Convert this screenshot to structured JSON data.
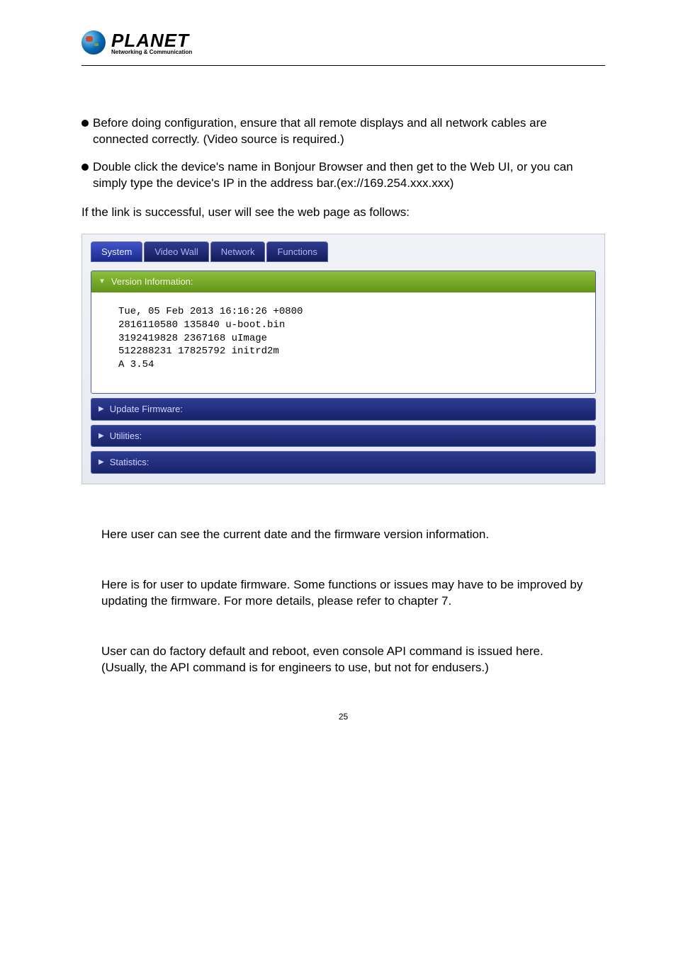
{
  "logo": {
    "word": "PLANET",
    "sub": "Networking & Communication"
  },
  "bullets": {
    "b1": "Before doing configuration, ensure that all remote displays and all network cables are connected correctly. (Video source is required.)",
    "b2": "Double click the device's name in Bonjour Browser and then get to the Web UI, or you can simply type the device's IP in the address bar.(ex://169.254.xxx.xxx)"
  },
  "linkline": "If the link is successful, user will see the web page as follows:",
  "tabs": {
    "system": "System",
    "video": "Video Wall",
    "network": "Network",
    "functions": "Functions"
  },
  "accordion": {
    "version_label": "Version Information:",
    "version_body_l1": "Tue, 05 Feb 2013 16:16:26 +0800",
    "version_body_l2": "2816110580 135840 u-boot.bin",
    "version_body_l3": "3192419828 2367168 uImage",
    "version_body_l4": "512288231 17825792 initrd2m",
    "version_body_l5": "A 3.54",
    "update_label": "Update Firmware:",
    "utilities_label": "Utilities:",
    "stats_label": "Statistics:"
  },
  "sections": {
    "s1": "Here user can  see the current date and the firmware version information.",
    "s2": "Here is for user to update firmware. Some functions or issues may have to be improved by updating the firmware. For more details, please refer to chapter 7.",
    "s3a": "User can do factory default and reboot, even console API command is issued here.",
    "s3b": "(Usually, the API command is for engineers to use, but not for endusers.)"
  },
  "page_number": "25"
}
